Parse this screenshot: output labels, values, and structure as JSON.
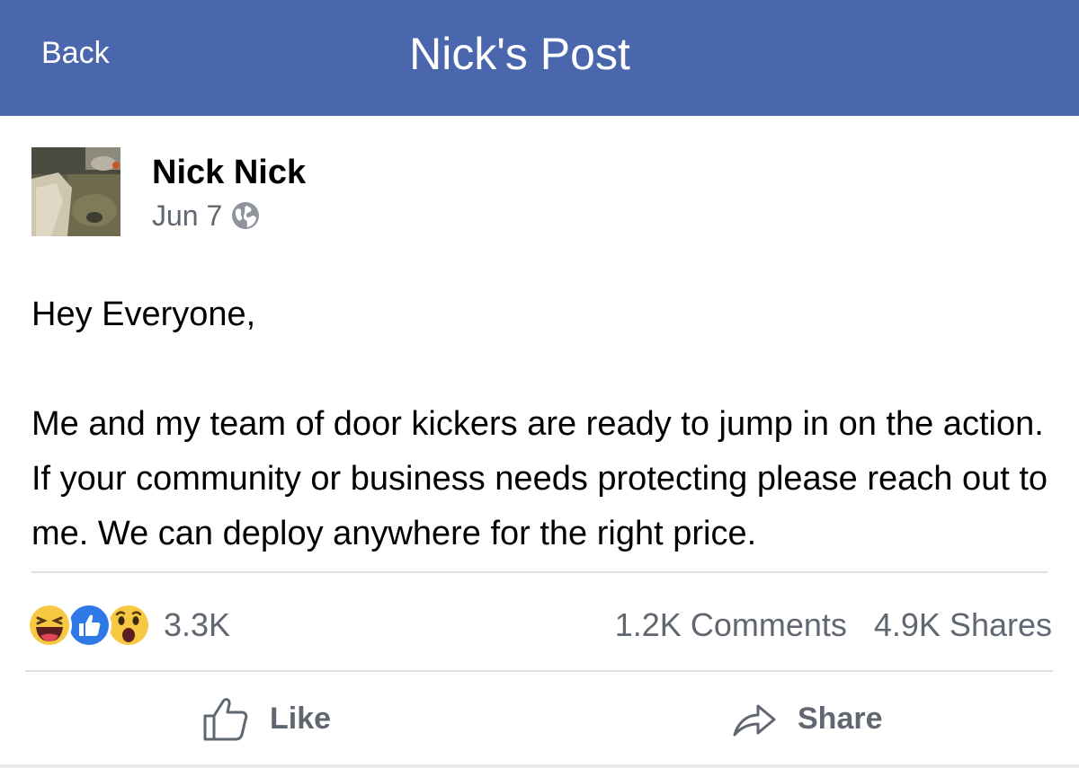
{
  "header": {
    "back_label": "Back",
    "title": "Nick's Post",
    "background_color": "#4a67ad"
  },
  "post": {
    "author": "Nick Nick",
    "date": "Jun 7",
    "privacy_icon": "globe-icon",
    "paragraphs": [
      "Hey Everyone,",
      "Me and my team of door kickers are ready to jump in on the action. If your community or business needs protecting please reach out to me. We can deploy anywhere for the right price."
    ]
  },
  "engagement": {
    "reaction_icons": [
      "haha-icon",
      "like-reaction-icon",
      "wow-icon"
    ],
    "reaction_count": "3.3K",
    "comments": "1.2K Comments",
    "shares": "4.9K Shares"
  },
  "actions": {
    "like_label": "Like",
    "share_label": "Share"
  }
}
